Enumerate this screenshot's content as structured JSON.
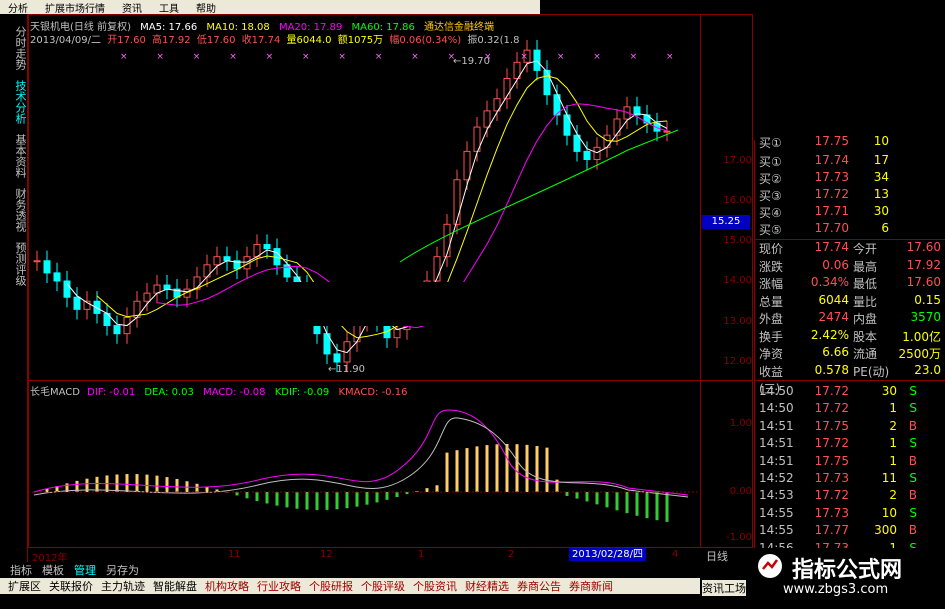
{
  "menu": [
    "分析",
    "扩展市场行情",
    "资讯",
    "工具",
    "帮助"
  ],
  "ad_text": "通达信金融终端",
  "left_tabs": [
    {
      "label": "分时走势",
      "active": false
    },
    {
      "label": "技术分析",
      "active": true
    },
    {
      "label": "基本资料",
      "active": false
    },
    {
      "label": "财务透视",
      "active": false
    },
    {
      "label": "预测评级",
      "active": false
    }
  ],
  "header": {
    "name": "天银机电(日线 前复权)",
    "ma5": "MA5: 17.66",
    "ma10": "MA10: 18.08",
    "ma20": "MA20: 17.89",
    "ma60": "MA60: 17.86",
    "date": "2013/04/09/二",
    "open": "开17.60",
    "high": "高17.92",
    "low": "低17.60",
    "close": "收17.74",
    "vol": "量6044.0",
    "amount": "额1075万",
    "change": "幅0.06(0.34%)",
    "amp": "振0.32(1.8"
  },
  "markers": "× × × × × × × × × × × × × × × ×",
  "annotations": {
    "high": "19.70",
    "low": "11.90"
  },
  "y_axis": [
    "17.00",
    "16.00",
    "15.00",
    "14.00",
    "13.00",
    "12.00"
  ],
  "current_price_tag": "15.25",
  "macd_axis": [
    "1.00",
    "0.00",
    "-1.00"
  ],
  "macd_header": {
    "name": "长毛MACD",
    "dif": "DIF: -0.01",
    "dea": "DEA: 0.03",
    "macd": "MACD: -0.08",
    "kdif": "KDIF: -0.09",
    "kmacd": "KMACD: -0.16"
  },
  "orderbook": [
    {
      "label": "买①",
      "price": "17.75",
      "vol": "10"
    },
    {
      "label": "买①",
      "price": "17.74",
      "vol": "17"
    },
    {
      "label": "买②",
      "price": "17.73",
      "vol": "34"
    },
    {
      "label": "买③",
      "price": "17.72",
      "vol": "13"
    },
    {
      "label": "买④",
      "price": "17.71",
      "vol": "30"
    },
    {
      "label": "买⑤",
      "price": "17.70",
      "vol": "6"
    }
  ],
  "stats": [
    {
      "l1": "现价",
      "v1": "17.74",
      "c1": "#ff5050",
      "l2": "今开",
      "v2": "17.60",
      "c2": "#ff5050"
    },
    {
      "l1": "涨跌",
      "v1": "0.06",
      "c1": "#ff5050",
      "l2": "最高",
      "v2": "17.92",
      "c2": "#ff5050"
    },
    {
      "l1": "涨幅",
      "v1": "0.34%",
      "c1": "#ff5050",
      "l2": "最低",
      "v2": "17.60",
      "c2": "#ff5050"
    },
    {
      "l1": "总量",
      "v1": "6044",
      "c1": "#ffff00",
      "l2": "量比",
      "v2": "0.15",
      "c2": "#ffff00"
    },
    {
      "l1": "外盘",
      "v1": "2474",
      "c1": "#ff5050",
      "l2": "内盘",
      "v2": "3570",
      "c2": "#00ff00"
    },
    {
      "l1": "换手",
      "v1": "2.42%",
      "c1": "#ffff00",
      "l2": "股本",
      "v2": "1.00亿",
      "c2": "#ffff00"
    },
    {
      "l1": "净资",
      "v1": "6.66",
      "c1": "#ffff00",
      "l2": "流通",
      "v2": "2500万",
      "c2": "#ffff00"
    },
    {
      "l1": "收益(三)",
      "v1": "0.578",
      "c1": "#ffff00",
      "l2": "PE(动)",
      "v2": "23.0",
      "c2": "#ffff00"
    }
  ],
  "ticks": [
    {
      "t": "14:50",
      "p": "17.72",
      "n": "30",
      "d": "S",
      "c": "#00ff00"
    },
    {
      "t": "14:50",
      "p": "17.72",
      "n": "1",
      "d": "S",
      "c": "#00ff00"
    },
    {
      "t": "14:51",
      "p": "17.75",
      "n": "2",
      "d": "B",
      "c": "#ff5050"
    },
    {
      "t": "14:51",
      "p": "17.72",
      "n": "1",
      "d": "S",
      "c": "#00ff00"
    },
    {
      "t": "14:51",
      "p": "17.75",
      "n": "1",
      "d": "B",
      "c": "#ff5050"
    },
    {
      "t": "14:52",
      "p": "17.73",
      "n": "11",
      "d": "S",
      "c": "#00ff00"
    },
    {
      "t": "14:53",
      "p": "17.72",
      "n": "2",
      "d": "B",
      "c": "#ff5050"
    },
    {
      "t": "14:55",
      "p": "17.73",
      "n": "10",
      "d": "S",
      "c": "#00ff00"
    },
    {
      "t": "14:55",
      "p": "17.77",
      "n": "300",
      "d": "B",
      "c": "#ff5050"
    },
    {
      "t": "14:56",
      "p": "17.73",
      "n": "1",
      "d": "S",
      "c": "#00ff00"
    }
  ],
  "date_axis": [
    "2012年",
    "11",
    "12",
    "1",
    "2",
    "4"
  ],
  "selected_date": "2013/02/28/四",
  "bottom_tabs1": [
    {
      "label": "指标",
      "on": false
    },
    {
      "label": "模板",
      "on": false
    },
    {
      "label": "管理",
      "on": true
    },
    {
      "label": "另存为",
      "on": false
    }
  ],
  "bottom_tabs2": [
    {
      "label": "扩展区",
      "hl": false
    },
    {
      "label": "关联报价",
      "hl": false
    },
    {
      "label": "主力轨迹",
      "hl": false
    },
    {
      "label": "智能解盘",
      "hl": false
    },
    {
      "label": "机构攻略",
      "hl": true
    },
    {
      "label": "行业攻略",
      "hl": true
    },
    {
      "label": "个股研报",
      "hl": true
    },
    {
      "label": "个股评级",
      "hl": true
    },
    {
      "label": "个股资讯",
      "hl": true
    },
    {
      "label": "财经精选",
      "hl": true
    },
    {
      "label": "券商公告",
      "hl": true
    },
    {
      "label": "券商新闻",
      "hl": true
    }
  ],
  "period_label": "日线",
  "info_label": "资讯工场",
  "watermark": {
    "title": "指标公式网",
    "url": "www.zbgs3.com"
  },
  "colors": {
    "up": "#ff5050",
    "down": "#00ffff",
    "frame": "#880000",
    "ma5": "#ffffff",
    "ma10": "#ffff00",
    "ma20": "#ff00ff",
    "ma60": "#00ff00"
  }
}
